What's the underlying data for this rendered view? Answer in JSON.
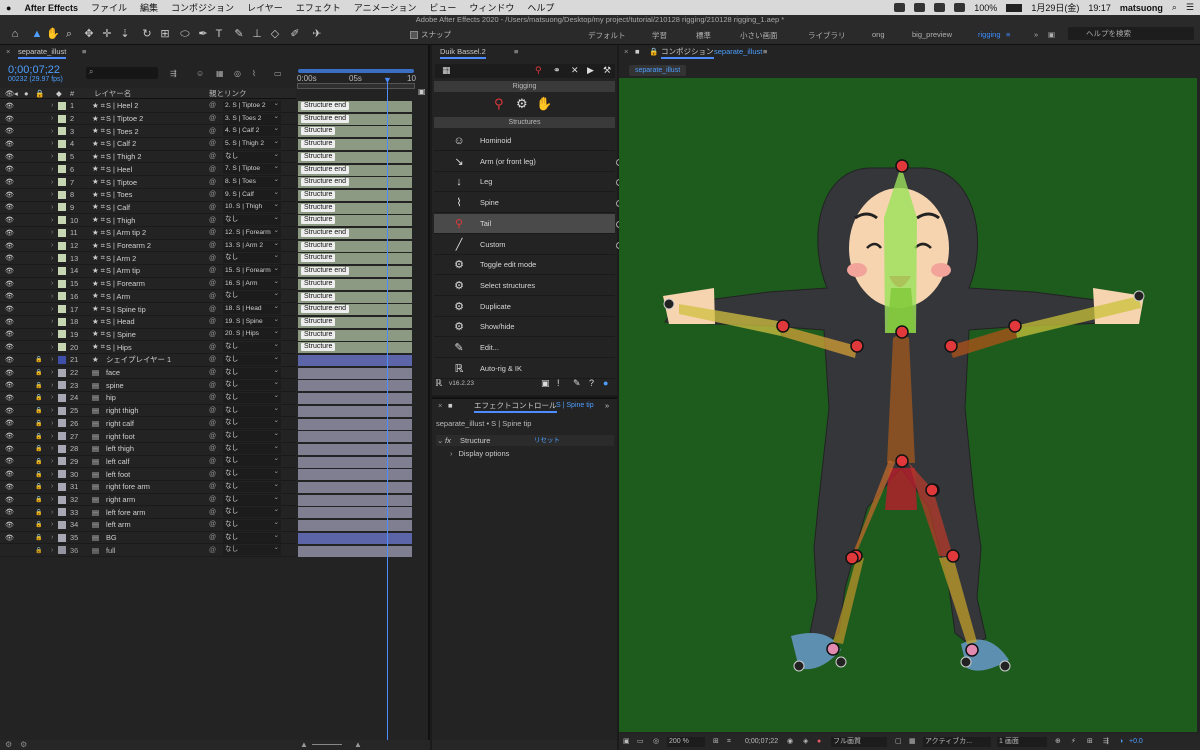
{
  "menubar": {
    "app": "After Effects",
    "items": [
      "ファイル",
      "編集",
      "コンポジション",
      "レイヤー",
      "エフェクト",
      "アニメーション",
      "ビュー",
      "ウィンドウ",
      "ヘルプ"
    ],
    "battery": "100%",
    "date": "1月29日(金)",
    "time": "19:17",
    "user": "matsuong"
  },
  "window_title": "Adobe After Effects 2020 - /Users/matsuong/Desktop/my project/tutorial/210128 rigging/210128 rigging_1.aep *",
  "toolbar": {
    "snap_label": "スナップ",
    "workspaces": [
      "デフォルト",
      "学習",
      "標準",
      "小さい画面",
      "ライブラリ",
      "ong",
      "big_preview",
      "rigging"
    ],
    "active_workspace": "rigging",
    "help_placeholder": "ヘルプを検索"
  },
  "timeline": {
    "tab": "separate_illust",
    "timecode": "0;00;07;22",
    "fps": "00232 (29.97 fps)",
    "col_layer": "レイヤー名",
    "col_parent": "親とリンク",
    "col_num": "#",
    "ruler": [
      "0:00s",
      "05s",
      "10"
    ],
    "rows": [
      {
        "n": "1",
        "name": "S | Heel 2",
        "parent": "2. S | Tiptoe 2",
        "shape": false,
        "bar": "Structure end"
      },
      {
        "n": "2",
        "name": "S | Tiptoe 2",
        "parent": "3. S | Toes 2",
        "shape": false,
        "bar": "Structure end"
      },
      {
        "n": "3",
        "name": "S | Toes 2",
        "parent": "4. S | Calf 2",
        "shape": false,
        "bar": "Structure"
      },
      {
        "n": "4",
        "name": "S | Calf 2",
        "parent": "5. S | Thigh 2",
        "shape": false,
        "bar": "Structure"
      },
      {
        "n": "5",
        "name": "S | Thigh 2",
        "parent": "なし",
        "shape": false,
        "bar": "Structure"
      },
      {
        "n": "6",
        "name": "S | Heel",
        "parent": "7. S | Tiptoe",
        "shape": false,
        "bar": "Structure end"
      },
      {
        "n": "7",
        "name": "S | Tiptoe",
        "parent": "8. S | Toes",
        "shape": false,
        "bar": "Structure end"
      },
      {
        "n": "8",
        "name": "S | Toes",
        "parent": "9. S | Calf",
        "shape": false,
        "bar": "Structure"
      },
      {
        "n": "9",
        "name": "S | Calf",
        "parent": "10. S | Thigh",
        "shape": false,
        "bar": "Structure"
      },
      {
        "n": "10",
        "name": "S | Thigh",
        "parent": "なし",
        "shape": false,
        "bar": "Structure"
      },
      {
        "n": "11",
        "name": "S | Arm tip 2",
        "parent": "12. S | Forearm",
        "shape": false,
        "bar": "Structure end"
      },
      {
        "n": "12",
        "name": "S | Forearm 2",
        "parent": "13. S | Arm 2",
        "shape": false,
        "bar": "Structure"
      },
      {
        "n": "13",
        "name": "S | Arm 2",
        "parent": "なし",
        "shape": false,
        "bar": "Structure"
      },
      {
        "n": "14",
        "name": "S | Arm tip",
        "parent": "15. S | Forearm",
        "shape": false,
        "bar": "Structure end"
      },
      {
        "n": "15",
        "name": "S | Forearm",
        "parent": "16. S | Arm",
        "shape": false,
        "bar": "Structure"
      },
      {
        "n": "16",
        "name": "S | Arm",
        "parent": "なし",
        "shape": false,
        "bar": "Structure"
      },
      {
        "n": "17",
        "name": "S | Spine tip",
        "parent": "18. S | Head",
        "shape": false,
        "bar": "Structure end"
      },
      {
        "n": "18",
        "name": "S | Head",
        "parent": "19. S | Spine",
        "shape": false,
        "bar": "Structure"
      },
      {
        "n": "19",
        "name": "S | Spine",
        "parent": "20. S | Hips",
        "shape": false,
        "bar": "Structure"
      },
      {
        "n": "20",
        "name": "S | Hips",
        "parent": "なし",
        "shape": false,
        "bar": "Structure"
      },
      {
        "n": "21",
        "name": "シェイプレイヤー 1",
        "parent": "なし",
        "shape": true,
        "bar": ""
      },
      {
        "n": "22",
        "name": "face",
        "parent": "なし",
        "shape": false,
        "bar": ""
      },
      {
        "n": "23",
        "name": "spine",
        "parent": "なし",
        "shape": false,
        "bar": ""
      },
      {
        "n": "24",
        "name": "hip",
        "parent": "なし",
        "shape": false,
        "bar": ""
      },
      {
        "n": "25",
        "name": "right thigh",
        "parent": "なし",
        "shape": false,
        "bar": ""
      },
      {
        "n": "26",
        "name": "right calf",
        "parent": "なし",
        "shape": false,
        "bar": ""
      },
      {
        "n": "27",
        "name": "right foot",
        "parent": "なし",
        "shape": false,
        "bar": ""
      },
      {
        "n": "28",
        "name": "left thigh",
        "parent": "なし",
        "shape": false,
        "bar": ""
      },
      {
        "n": "29",
        "name": "left calf",
        "parent": "なし",
        "shape": false,
        "bar": ""
      },
      {
        "n": "30",
        "name": "left foot",
        "parent": "なし",
        "shape": false,
        "bar": ""
      },
      {
        "n": "31",
        "name": "right fore arm",
        "parent": "なし",
        "shape": false,
        "bar": ""
      },
      {
        "n": "32",
        "name": "right arm",
        "parent": "なし",
        "shape": false,
        "bar": ""
      },
      {
        "n": "33",
        "name": "left fore arm",
        "parent": "なし",
        "shape": false,
        "bar": ""
      },
      {
        "n": "34",
        "name": "left arm",
        "parent": "なし",
        "shape": false,
        "bar": ""
      },
      {
        "n": "35",
        "name": "BG",
        "parent": "なし",
        "shape": false,
        "bar": ""
      },
      {
        "n": "36",
        "name": "full",
        "parent": "なし",
        "shape": false,
        "bar": ""
      }
    ]
  },
  "duik": {
    "tab": "Duik Bassel.2",
    "rigging": "Rigging",
    "structures": "Structures",
    "version": "v16.2.23",
    "items": [
      "Hominoid",
      "Arm (or front leg)",
      "Leg",
      "Spine",
      "Tail",
      "Custom",
      "Toggle edit mode",
      "Select structures",
      "Duplicate",
      "Show/hide",
      "Edit...",
      "Auto-rig & IK"
    ],
    "selected": "Tail"
  },
  "effects": {
    "tab": "エフェクトコントロール",
    "tab_layer": "S | Spine tip",
    "path": "separate_illust • S | Spine tip",
    "effect": "Structure",
    "reset": "リセット",
    "group": "Display options"
  },
  "comp": {
    "tab": "コンポジション",
    "tab_name": "separate_illust",
    "subtab": "separate_illust",
    "viewbar": {
      "zoom": "200 %",
      "timecode": "0;00;07;22",
      "quality": "フル画質",
      "view": "アクティブカ...",
      "views": "1 画面",
      "exposure": "+0.0"
    }
  }
}
